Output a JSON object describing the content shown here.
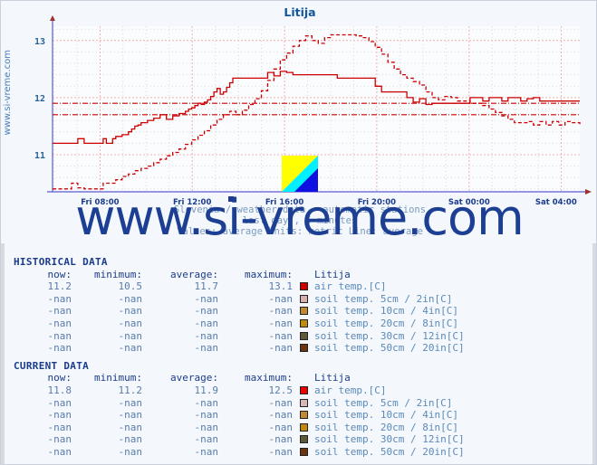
{
  "page": {
    "vertical_url": "www.si-vreme.com",
    "watermark": "www.si-vreme.com"
  },
  "chart": {
    "title": "Litija",
    "subtitle_line1": "Slovenia / weather data - automatic stations",
    "subtitle_line2": "last day , 5 minutes",
    "subtitle_line3": "Values: average  Units: metric  Line: average",
    "axis_color": "#5a5ad0",
    "series_color": "#cc0000",
    "grid_color_major": "#f0b0b0",
    "grid_color_minor": "#d8d8d8",
    "logo_colors": {
      "top": "#ffff00",
      "band": "#00f0ff",
      "bottom": "#1010e0"
    }
  },
  "chart_data": {
    "type": "line",
    "title": "Litija",
    "xlabel": "",
    "ylabel": "",
    "ylim": [
      10.35,
      13.25
    ],
    "yticks": [
      11,
      12,
      13
    ],
    "ytick_labels": [
      "11",
      "12",
      "13"
    ],
    "xtick_labels": [
      "Fri 08:00",
      "Fri 12:00",
      "Fri 16:00",
      "Fri 20:00",
      "Sat 00:00",
      "Sat 04:00"
    ],
    "xtick_positions": [
      0.09,
      0.265,
      0.44,
      0.615,
      0.79,
      0.955
    ],
    "grid": true,
    "legend_position": "below-table",
    "reference_lines": [
      {
        "label": "current average",
        "value": 11.9,
        "style": "dash-dot",
        "color": "#cc0000"
      },
      {
        "label": "historical average",
        "value": 11.7,
        "style": "dash-dot",
        "color": "#cc0000"
      }
    ],
    "series": [
      {
        "name": "air temp. current [C]",
        "style": "solid",
        "color": "#cc0000",
        "x": [
          0.0,
          0.012,
          0.024,
          0.036,
          0.048,
          0.06,
          0.072,
          0.084,
          0.09,
          0.096,
          0.102,
          0.108,
          0.114,
          0.12,
          0.132,
          0.144,
          0.15,
          0.156,
          0.162,
          0.168,
          0.18,
          0.192,
          0.204,
          0.216,
          0.228,
          0.24,
          0.252,
          0.258,
          0.264,
          0.27,
          0.276,
          0.282,
          0.288,
          0.294,
          0.3,
          0.306,
          0.312,
          0.318,
          0.324,
          0.33,
          0.336,
          0.342,
          0.348,
          0.354,
          0.36,
          0.372,
          0.384,
          0.396,
          0.408,
          0.42,
          0.432,
          0.444,
          0.456,
          0.468,
          0.48,
          0.492,
          0.504,
          0.516,
          0.528,
          0.54,
          0.552,
          0.564,
          0.576,
          0.588,
          0.6,
          0.612,
          0.624,
          0.636,
          0.648,
          0.66,
          0.672,
          0.684,
          0.696,
          0.708,
          0.72,
          0.732,
          0.744,
          0.756,
          0.768,
          0.78,
          0.792,
          0.804,
          0.816,
          0.828,
          0.84,
          0.852,
          0.864,
          0.876,
          0.888,
          0.9,
          0.912,
          0.924,
          0.936,
          0.948,
          0.96,
          0.972,
          0.984,
          1.0
        ],
        "y": [
          11.2,
          11.2,
          11.2,
          11.2,
          11.28,
          11.2,
          11.2,
          11.2,
          11.2,
          11.28,
          11.2,
          11.2,
          11.28,
          11.32,
          11.35,
          11.4,
          11.45,
          11.5,
          11.52,
          11.56,
          11.6,
          11.64,
          11.7,
          11.62,
          11.68,
          11.72,
          11.76,
          11.8,
          11.82,
          11.86,
          11.9,
          11.88,
          11.92,
          11.96,
          12.02,
          12.1,
          12.16,
          12.06,
          12.1,
          12.18,
          12.26,
          12.34,
          12.34,
          12.34,
          12.34,
          12.34,
          12.34,
          12.34,
          12.44,
          12.38,
          12.46,
          12.44,
          12.4,
          12.4,
          12.4,
          12.4,
          12.4,
          12.4,
          12.4,
          12.34,
          12.34,
          12.34,
          12.34,
          12.34,
          12.34,
          12.2,
          12.1,
          12.1,
          12.1,
          12.1,
          12.0,
          11.92,
          11.98,
          11.88,
          11.9,
          11.9,
          11.9,
          11.9,
          11.9,
          11.9,
          12.0,
          12.0,
          11.94,
          12.0,
          12.0,
          11.94,
          12.0,
          12.0,
          11.94,
          11.98,
          12.0,
          11.94,
          11.94,
          11.94,
          11.94,
          11.94,
          11.94,
          11.94
        ]
      },
      {
        "name": "air temp. historical [C]",
        "style": "dashed",
        "color": "#cc0000",
        "x": [
          0.0,
          0.012,
          0.024,
          0.036,
          0.048,
          0.06,
          0.072,
          0.084,
          0.096,
          0.108,
          0.12,
          0.132,
          0.144,
          0.156,
          0.168,
          0.18,
          0.192,
          0.204,
          0.216,
          0.228,
          0.24,
          0.252,
          0.264,
          0.276,
          0.288,
          0.3,
          0.312,
          0.324,
          0.336,
          0.348,
          0.36,
          0.372,
          0.384,
          0.396,
          0.408,
          0.42,
          0.432,
          0.444,
          0.456,
          0.468,
          0.48,
          0.492,
          0.504,
          0.516,
          0.528,
          0.54,
          0.552,
          0.564,
          0.576,
          0.588,
          0.6,
          0.612,
          0.624,
          0.636,
          0.648,
          0.66,
          0.672,
          0.684,
          0.696,
          0.708,
          0.72,
          0.732,
          0.744,
          0.756,
          0.768,
          0.78,
          0.792,
          0.804,
          0.816,
          0.828,
          0.84,
          0.852,
          0.864,
          0.876,
          0.888,
          0.9,
          0.912,
          0.924,
          0.936,
          0.948,
          0.96,
          0.972,
          0.984,
          1.0
        ],
        "y": [
          10.4,
          10.4,
          10.4,
          10.5,
          10.42,
          10.4,
          10.4,
          10.4,
          10.5,
          10.5,
          10.56,
          10.62,
          10.66,
          10.72,
          10.76,
          10.8,
          10.86,
          10.92,
          10.98,
          11.04,
          11.1,
          11.18,
          11.26,
          11.34,
          11.42,
          11.52,
          11.62,
          11.7,
          11.76,
          11.7,
          11.78,
          11.88,
          11.98,
          12.12,
          12.3,
          12.5,
          12.66,
          12.78,
          12.9,
          13.0,
          13.08,
          13.0,
          12.95,
          13.05,
          13.1,
          13.1,
          13.1,
          13.1,
          13.08,
          13.05,
          12.98,
          12.88,
          12.76,
          12.62,
          12.5,
          12.4,
          12.34,
          12.28,
          12.22,
          12.1,
          12.0,
          11.96,
          12.02,
          12.0,
          11.94,
          11.94,
          11.9,
          11.9,
          11.86,
          11.8,
          11.74,
          11.68,
          11.62,
          11.56,
          11.56,
          11.58,
          11.52,
          11.58,
          11.52,
          11.58,
          11.52,
          11.58,
          11.56,
          11.5
        ]
      }
    ]
  },
  "historical": {
    "section_title": "HISTORICAL DATA",
    "columns": [
      "now:",
      "minimum:",
      "average:",
      "maximum:"
    ],
    "station": "Litija",
    "rows": [
      {
        "now": "11.2",
        "min": "10.5",
        "avg": "11.7",
        "max": "13.1",
        "color": "#cc0000",
        "label": "air temp.[C]"
      },
      {
        "now": "-nan",
        "min": "-nan",
        "avg": "-nan",
        "max": "-nan",
        "color": "#d6aeae",
        "label": "soil temp. 5cm / 2in[C]"
      },
      {
        "now": "-nan",
        "min": "-nan",
        "avg": "-nan",
        "max": "-nan",
        "color": "#c08a34",
        "label": "soil temp. 10cm / 4in[C]"
      },
      {
        "now": "-nan",
        "min": "-nan",
        "avg": "-nan",
        "max": "-nan",
        "color": "#c08a10",
        "label": "soil temp. 20cm / 8in[C]"
      },
      {
        "now": "-nan",
        "min": "-nan",
        "avg": "-nan",
        "max": "-nan",
        "color": "#5a5a38",
        "label": "soil temp. 30cm / 12in[C]"
      },
      {
        "now": "-nan",
        "min": "-nan",
        "avg": "-nan",
        "max": "-nan",
        "color": "#6b3410",
        "label": "soil temp. 50cm / 20in[C]"
      }
    ]
  },
  "current": {
    "section_title": "CURRENT DATA",
    "columns": [
      "now:",
      "minimum:",
      "average:",
      "maximum:"
    ],
    "station": "Litija",
    "rows": [
      {
        "now": "11.8",
        "min": "11.2",
        "avg": "11.9",
        "max": "12.5",
        "color": "#ee0000",
        "label": "air temp.[C]"
      },
      {
        "now": "-nan",
        "min": "-nan",
        "avg": "-nan",
        "max": "-nan",
        "color": "#d6b6b6",
        "label": "soil temp. 5cm / 2in[C]"
      },
      {
        "now": "-nan",
        "min": "-nan",
        "avg": "-nan",
        "max": "-nan",
        "color": "#c08a34",
        "label": "soil temp. 10cm / 4in[C]"
      },
      {
        "now": "-nan",
        "min": "-nan",
        "avg": "-nan",
        "max": "-nan",
        "color": "#c08a10",
        "label": "soil temp. 20cm / 8in[C]"
      },
      {
        "now": "-nan",
        "min": "-nan",
        "avg": "-nan",
        "max": "-nan",
        "color": "#5a5a38",
        "label": "soil temp. 30cm / 12in[C]"
      },
      {
        "now": "-nan",
        "min": "-nan",
        "avg": "-nan",
        "max": "-nan",
        "color": "#6b3410",
        "label": "soil temp. 50cm / 20in[C]"
      }
    ]
  }
}
